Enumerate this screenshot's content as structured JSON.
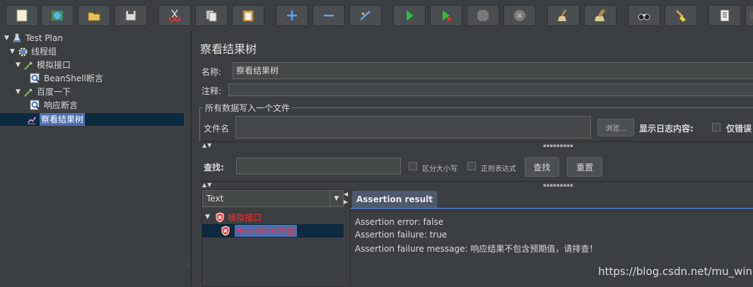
{
  "toolbar": {
    "icons": [
      "new-icon",
      "templates-icon",
      "open-icon",
      "save-icon",
      "cut-icon",
      "copy-icon",
      "paste-icon",
      "expand-icon",
      "collapse-icon",
      "toggle-icon",
      "start-icon",
      "start-no-pause-icon",
      "stop-icon",
      "shutdown-icon",
      "clear-icon",
      "clear-all-icon",
      "search-icon",
      "reset-search-icon",
      "function-helper-icon",
      "help-icon"
    ]
  },
  "tree": {
    "test_plan": "Test Plan",
    "thread_group": "线程组",
    "mock_api": "模拟接口",
    "beanshell_assert": "BeanShell断言",
    "baidu": "百度一下",
    "response_assert": "响应断言",
    "view_results_tree": "察看结果树"
  },
  "panel": {
    "title": "察看结果树",
    "name_label": "名称:",
    "name_value": "察看结果树",
    "comment_label": "注释:",
    "comment_value": "",
    "file_group_title": "所有数据写入一个文件",
    "filename_label": "文件名",
    "filename_value": "",
    "browse_label": "浏览...",
    "log_label": "显示日志内容:",
    "errors_only_label": "仅错误"
  },
  "search": {
    "label": "查找:",
    "value": "",
    "case_label": "区分大小写",
    "regex_label": "正则表达式",
    "find_button": "查找",
    "reset_button": "重置"
  },
  "results": {
    "renderer": "Text",
    "samples": [
      {
        "label": "模拟接口"
      },
      {
        "label": "BeanShell断言"
      }
    ],
    "tab_label": "Assertion result",
    "lines": [
      "Assertion error: false",
      "Assertion failure: true",
      "Assertion failure message: 响应结果不包含预期值，请排查！"
    ]
  },
  "watermark": "https://blog.csdn.net/mu_wind",
  "colors": {
    "background": "#3c3f41",
    "selection": "#4b6eaf",
    "error": "#ff2b2b"
  }
}
